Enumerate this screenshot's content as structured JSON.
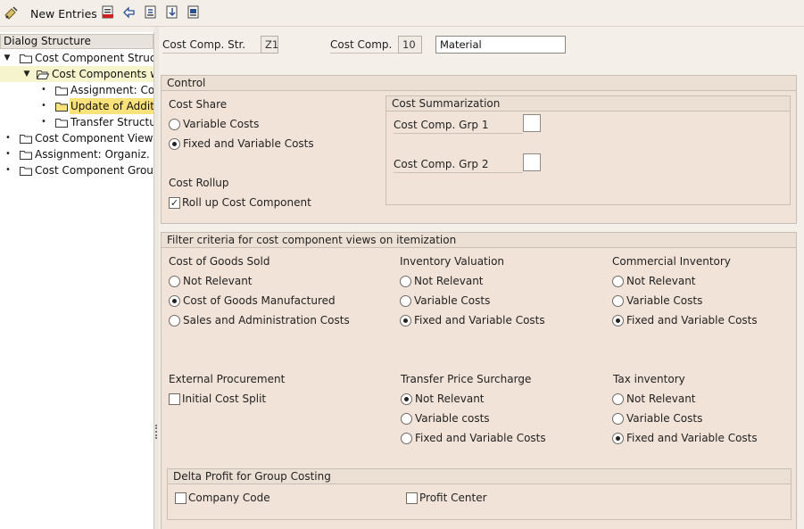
{
  "toolbar": {
    "new_entries_label": "New Entries",
    "icons": [
      "glasses-change-icon",
      "new-entries-icon",
      "delete-icon",
      "undo-icon",
      "copy-icon",
      "import-icon",
      "export-icon"
    ]
  },
  "dialog_structure": {
    "header": "Dialog Structure",
    "items": [
      {
        "label": "Cost Component Structu",
        "expanded": true,
        "level": 0
      },
      {
        "label": "Cost Components wi",
        "expanded": true,
        "level": 1,
        "open_folder": true
      },
      {
        "label": "Assignment: Cost",
        "level": 2
      },
      {
        "label": "Update of Additiv",
        "level": 2,
        "selected": true
      },
      {
        "label": "Transfer Structur",
        "level": 2
      },
      {
        "label": "Cost Component Views",
        "level": 0
      },
      {
        "label": "Assignment: Organiz. Un",
        "level": 0
      },
      {
        "label": "Cost Component Groups",
        "level": 0
      }
    ]
  },
  "header_fields": {
    "cost_comp_str_label": "Cost Comp. Str.",
    "cost_comp_str_value": "Z1",
    "cost_comp_label": "Cost Comp.",
    "cost_comp_value": "10",
    "cost_comp_description": "Material"
  },
  "control": {
    "title": "Control",
    "cost_share_label": "Cost Share",
    "cost_share_options": [
      {
        "label": "Variable Costs",
        "selected": false
      },
      {
        "label": "Fixed and Variable Costs",
        "selected": true
      }
    ],
    "cost_rollup_label": "Cost Rollup",
    "rollup_checkbox": {
      "label": "Roll up Cost Component",
      "checked": true
    },
    "cost_summarization": {
      "title": "Cost Summarization",
      "grp1_label": "Cost Comp. Grp 1",
      "grp1_value": "",
      "grp2_label": "Cost Comp. Grp 2",
      "grp2_value": ""
    }
  },
  "filter": {
    "title": "Filter criteria for cost component views on itemization",
    "cogs": {
      "label": "Cost of Goods Sold",
      "options": [
        {
          "label": "Not Relevant",
          "selected": false
        },
        {
          "label": "Cost of Goods Manufactured",
          "selected": true
        },
        {
          "label": "Sales and Administration Costs",
          "selected": false
        }
      ]
    },
    "inventory_valuation": {
      "label": "Inventory Valuation",
      "options": [
        {
          "label": "Not Relevant",
          "selected": false
        },
        {
          "label": "Variable Costs",
          "selected": false
        },
        {
          "label": "Fixed and Variable Costs",
          "selected": true
        }
      ]
    },
    "commercial_inventory": {
      "label": "Commercial Inventory",
      "options": [
        {
          "label": "Not Relevant",
          "selected": false
        },
        {
          "label": "Variable Costs",
          "selected": false
        },
        {
          "label": "Fixed and Variable Costs",
          "selected": true
        }
      ]
    },
    "external_procurement": {
      "label": "External Procurement",
      "checkbox": {
        "label": "Initial Cost Split",
        "checked": false
      }
    },
    "transfer_price": {
      "label": "Transfer Price Surcharge",
      "options": [
        {
          "label": "Not Relevant",
          "selected": true
        },
        {
          "label": "Variable costs",
          "selected": false
        },
        {
          "label": "Fixed and Variable Costs",
          "selected": false
        }
      ]
    },
    "tax_inventory": {
      "label": "Tax inventory",
      "options": [
        {
          "label": "Not Relevant",
          "selected": false
        },
        {
          "label": "Variable Costs",
          "selected": false
        },
        {
          "label": "Fixed and Variable Costs",
          "selected": true
        }
      ]
    },
    "delta_profit": {
      "title": "Delta Profit for Group Costing",
      "company_code": {
        "label": "Company Code",
        "checked": false
      },
      "profit_center": {
        "label": "Profit Center",
        "checked": false
      }
    }
  }
}
